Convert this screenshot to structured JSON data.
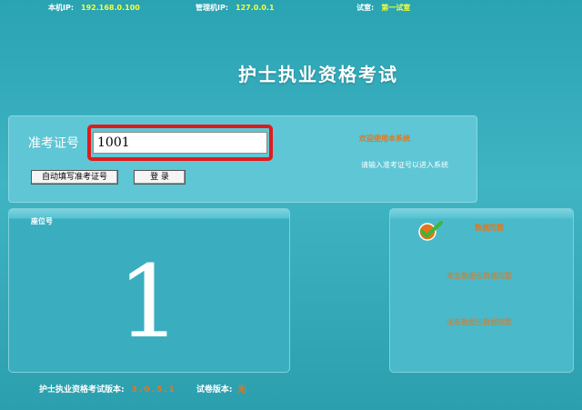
{
  "top_bar": {
    "local_ip_label": "本机IP:",
    "local_ip": "192.168.0.100",
    "admin_ip_label": "管理机IP:",
    "admin_ip": "127.0.0.1",
    "room_label": "试室:",
    "room": "第一试室"
  },
  "title": "护士执业资格考试",
  "login": {
    "candidate_label": "准考证号",
    "candidate_value": "1001",
    "auto_fill_button": "自动填写准考证号",
    "login_button": "登 录",
    "welcome": "欢迎使用本系统",
    "hint": "请输入准考证号以进入系统"
  },
  "seat": {
    "label": "座位号",
    "number": "1"
  },
  "status": {
    "main": "数据完整",
    "candidate_data": "考生数据包数据完整",
    "paper_data": "试卷数据包数据完整"
  },
  "footer": {
    "version_label": "护士执业资格考试版本:",
    "version": "3.0.5.1",
    "paper_version_label": "试卷版本:",
    "paper_version": "无"
  },
  "colors": {
    "background": "#2aa3b3",
    "accent_orange": "#e8751a",
    "ip_yellow": "#f2ff3a",
    "highlight_red": "#e11b1b"
  }
}
